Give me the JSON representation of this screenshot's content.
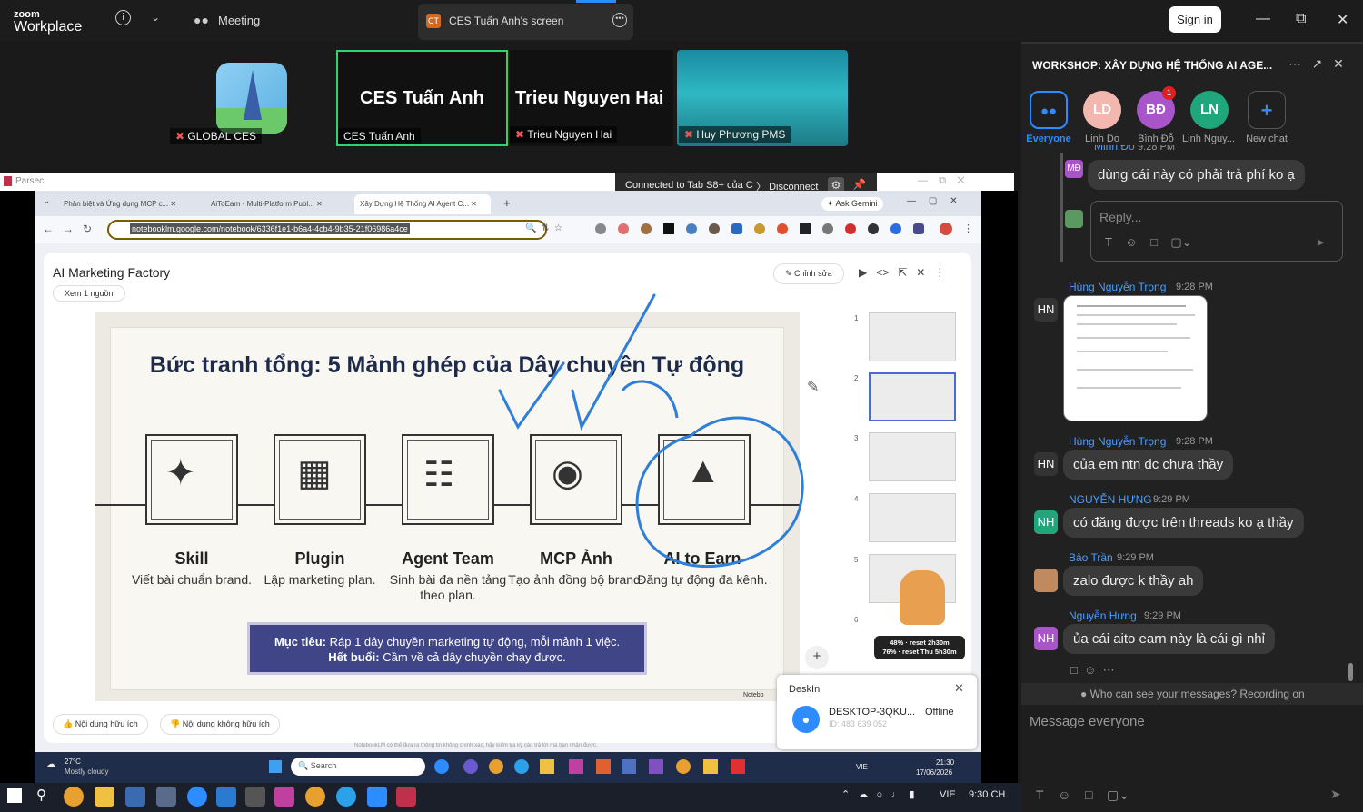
{
  "top_bar": {
    "logo_line1": "zoom",
    "logo_line2": "Workplace",
    "info_label": "i",
    "meeting_label": "Meeting",
    "share_tab_label": "CES Tuấn Anh's screen",
    "share_tab_icon_text": "CT",
    "sign_in": "Sign in"
  },
  "videos": [
    {
      "name": "GLOBAL CES",
      "big": ""
    },
    {
      "name": "CES Tuấn Anh",
      "big": "CES Tuấn Anh"
    },
    {
      "name": "Trieu Nguyen Hai",
      "big": "Trieu Nguyen Hai"
    },
    {
      "name": "Huy Phương PMS",
      "big": ""
    }
  ],
  "parsec": {
    "title": "Parsec",
    "connected": "Connected to Tab S8+ của C",
    "disconnect": "Disconnect"
  },
  "browser": {
    "tabs": [
      "Phân biệt và Ứng dụng MCP c...",
      "AiToEarn - Multi-Platform Publ...",
      "Xây Dựng Hệ Thống AI Agent C..."
    ],
    "ask": "Ask Gemini",
    "url": "notebooklm.google.com/notebook/6336f1e1-b6a4-4cb4-9b35-21f06986a4ce"
  },
  "notebook": {
    "title": "AI Marketing Factory",
    "source_btn": "Xem 1 nguồn",
    "edit_btn": "Chỉnh sửa",
    "useful": "Nội dung hữu ích",
    "not_useful": "Nội dung không hữu ích",
    "disclaimer": "NotebookLM có thể đưa ra thông tin không chính xác, hãy kiểm tra kỹ câu trả lời mà bạn nhận được.",
    "watermark": "Notebo"
  },
  "slide": {
    "title": "Bức tranh tổng: 5 Mảnh ghép của Dây chuyền Tự động",
    "steps": [
      {
        "name": "Skill",
        "desc": "Viết bài chuẩn brand."
      },
      {
        "name": "Plugin",
        "desc": "Lập marketing plan."
      },
      {
        "name": "Agent Team",
        "desc": "Sinh bài đa nền tảng theo plan."
      },
      {
        "name": "MCP Ảnh",
        "desc": "Tạo ảnh đồng bộ brand."
      },
      {
        "name": "AI to Earn",
        "desc": "Đăng tự động đa kênh."
      }
    ],
    "goal_label": "Mục tiêu:",
    "goal_text": "Ráp 1 dây chuyền marketing tự động, mỗi mảnh 1 việc.",
    "end_label": "Hết buổi:",
    "end_text": "Cầm về cả dây chuyền chạy được."
  },
  "thumb_numbers": [
    "1",
    "2",
    "3",
    "4",
    "5",
    "6"
  ],
  "usage_badge": {
    "line1": "48% · reset 2h30m",
    "line2": "76% · reset Thu 5h30m"
  },
  "deskin": {
    "title": "DeskIn",
    "device": "DESKTOP-3QKU...",
    "status": "Offline",
    "id": "ID: 483 639 052"
  },
  "remote_taskbar": {
    "weather_temp": "27°C",
    "weather_desc": "Mostly cloudy",
    "search": "Search",
    "lang": "VIE",
    "time": "21:30",
    "date": "17/06/2026"
  },
  "chat": {
    "header": "WORKSHOP: XÂY DỰNG HỆ THỐNG AI AGE...",
    "recipients": [
      {
        "label": "Everyone",
        "initials": "",
        "color": "#1f1f1f"
      },
      {
        "label": "Linh Do",
        "initials": "LD",
        "color": "#f2b8b0"
      },
      {
        "label": "Bình Đỗ",
        "initials": "BĐ",
        "color": "#a855c9"
      },
      {
        "label": "Linh Nguy...",
        "initials": "LN",
        "color": "#1fa67a"
      },
      {
        "label": "New chat",
        "initials": "+",
        "color": "#1f1f1f"
      }
    ],
    "badge": "1",
    "top_sender": "Minh Đỗ",
    "top_time": "9:28 PM",
    "top_initials": "MĐ",
    "top_msg": "dùng cái này có phải trả phí ko ạ",
    "reply_placeholder": "Reply...",
    "messages": [
      {
        "sender": "Hùng Nguyễn Trọng",
        "time": "9:28 PM",
        "initials": "HN",
        "text": ""
      },
      {
        "sender": "Hùng Nguyễn Trọng",
        "time": "9:28 PM",
        "initials": "HN",
        "text": "của em ntn đc chưa thầy"
      },
      {
        "sender": "NGUYỄN HƯNG",
        "time": "9:29 PM",
        "initials": "NH",
        "text": "có đăng được trên threads ko ạ thầy"
      },
      {
        "sender": "Bảo Trần",
        "time": "9:29 PM",
        "initials": "",
        "text": "zalo được k thầy ah"
      },
      {
        "sender": "Nguyễn Hưng",
        "time": "9:29 PM",
        "initials": "NH",
        "text": "ủa cái aito earn này là cái gì nhỉ"
      }
    ],
    "who_can_see": "Who can see your messages? Recording on",
    "message_placeholder": "Message everyone"
  },
  "taskbar": {
    "lang": "VIE",
    "time": "9:30 CH"
  },
  "colors": {
    "accent": "#4a9eff",
    "zoom_bg": "#1a1a1a",
    "goal_bg": "#3f4587",
    "annotation": "#2e7fd9"
  }
}
